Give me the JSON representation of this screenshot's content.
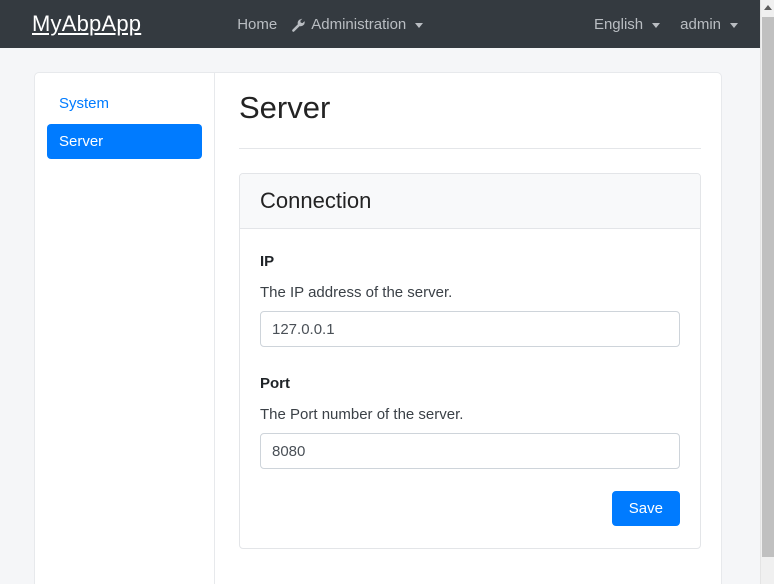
{
  "navbar": {
    "brand": "MyAbpApp",
    "center_links": [
      {
        "label": "Home",
        "icon": "",
        "caret": false
      },
      {
        "label": "Administration",
        "icon": "wrench-icon",
        "caret": true
      }
    ],
    "right_links": [
      {
        "label": "English",
        "caret": true
      },
      {
        "label": "admin",
        "caret": true
      }
    ],
    "background": "#343a40",
    "text_color": "#b9bdc2"
  },
  "sidebar": {
    "items": [
      {
        "label": "System",
        "active": false
      },
      {
        "label": "Server",
        "active": true
      }
    ],
    "active_color": "#007bff"
  },
  "main": {
    "page_title": "Server",
    "panel": {
      "title": "Connection",
      "fields": [
        {
          "label": "IP",
          "description": "The IP address of the server.",
          "value": "127.0.0.1",
          "placeholder": ""
        },
        {
          "label": "Port",
          "description": "The Port number of the server.",
          "value": "8080",
          "placeholder": ""
        }
      ],
      "save_label": "Save"
    }
  },
  "scrollbar": {
    "up_arrow": "scroll-up-arrow-icon"
  }
}
